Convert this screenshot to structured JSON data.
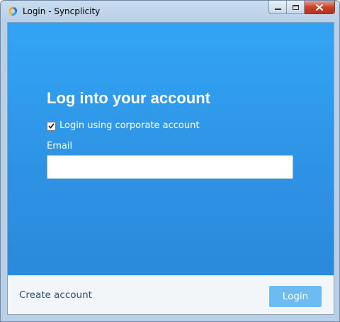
{
  "window": {
    "title": "Login - Syncplicity",
    "icon": "syncplicity-logo-icon",
    "controls": [
      "minimize",
      "maximize",
      "close"
    ]
  },
  "login": {
    "heading": "Log into your account",
    "corporate_checkbox": {
      "label": "Login using corporate account",
      "checked": true
    },
    "email_label": "Email",
    "email_value": "",
    "email_placeholder": ""
  },
  "footer": {
    "create_account": "Create account",
    "login_button": "Login"
  },
  "colors": {
    "panel_blue": "#2e92e4",
    "login_button": "#6cbcf2",
    "link_text": "#2d4f73"
  }
}
